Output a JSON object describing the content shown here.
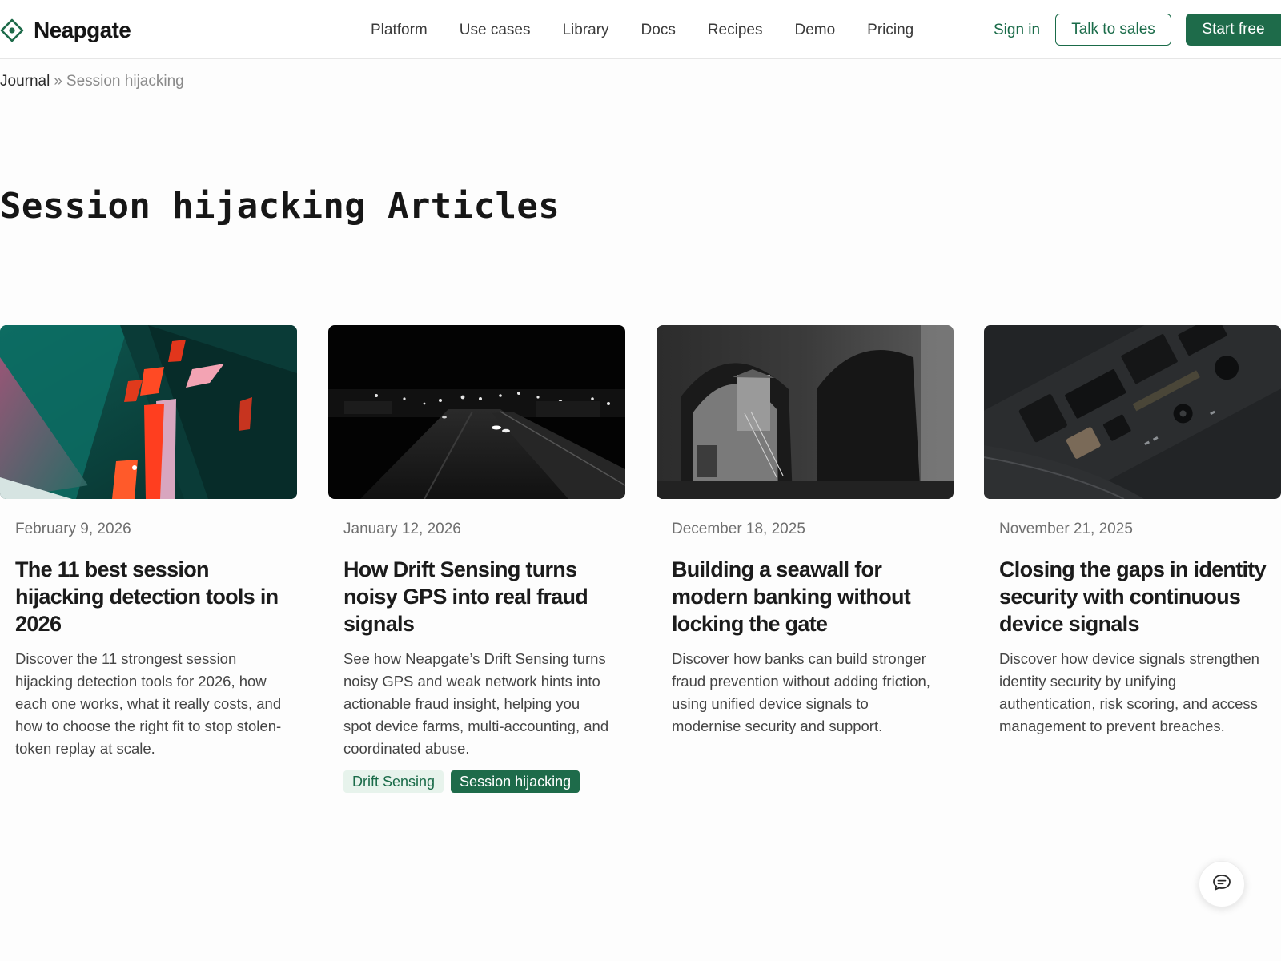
{
  "brand": {
    "name": "Neapgate",
    "accent": "#1e6b4a"
  },
  "nav": {
    "items": [
      {
        "label": "Platform"
      },
      {
        "label": "Use cases"
      },
      {
        "label": "Library"
      },
      {
        "label": "Docs"
      },
      {
        "label": "Recipes"
      },
      {
        "label": "Demo"
      },
      {
        "label": "Pricing"
      }
    ],
    "sign_in": "Sign in",
    "talk_to_sales": "Talk to sales",
    "start_free": "Start free"
  },
  "breadcrumb": {
    "parent": "Journal",
    "separator": "»",
    "current": "Session hijacking"
  },
  "page": {
    "title": "Session hijacking Articles"
  },
  "articles": [
    {
      "date": "February 9, 2026",
      "title": "The 11 best session hijacking detection tools in 2026",
      "excerpt": "Discover the 11 strongest session hijacking detection tools for 2026, how each one works, what it really costs, and how to choose the right fit to stop stolen-token replay at scale.",
      "image": "abstract-teal-red-geometry"
    },
    {
      "date": "January 12, 2026",
      "title": "How Drift Sensing turns noisy GPS into real fraud signals",
      "excerpt": "See how Neapgate’s Drift Sensing turns noisy GPS and weak network hints into actionable fraud insight, helping you spot device farms, multi-accounting, and coordinated abuse.",
      "image": "night-street-monochrome",
      "tags": [
        "Drift Sensing",
        "Session hijacking"
      ]
    },
    {
      "date": "December 18, 2025",
      "title": "Building a seawall for modern banking without locking the gate",
      "excerpt": "Discover how banks can build stronger fraud prevention without adding friction, using unified device signals to modernise security and support.",
      "image": "stone-archway-monochrome"
    },
    {
      "date": "November 21, 2025",
      "title": "Closing the gaps in identity security with continuous device signals",
      "excerpt": "Discover how device signals strengthen identity security by unifying authentication, risk scoring, and access management to prevent breaches.",
      "image": "circuit-board-dark"
    }
  ],
  "chat": {
    "icon": "chat-bubble-icon"
  }
}
